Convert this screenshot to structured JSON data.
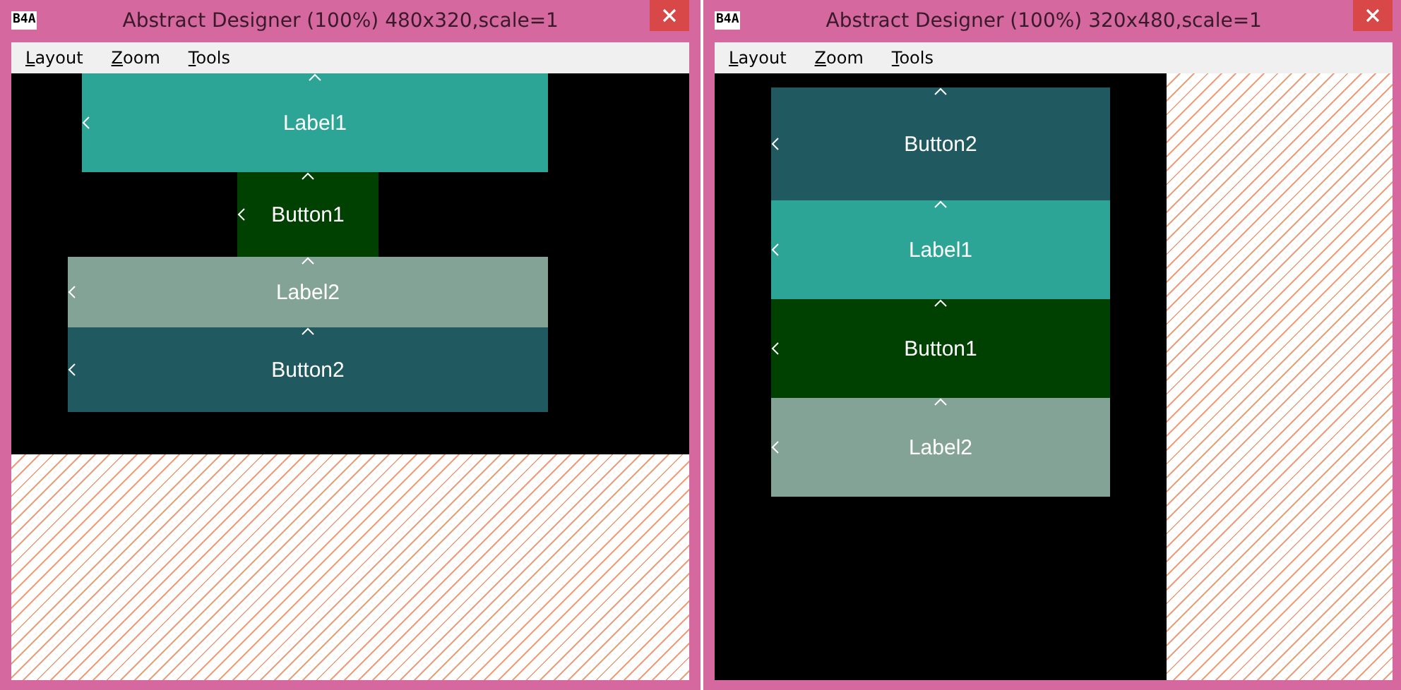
{
  "windows": [
    {
      "logo": "B4A",
      "title": "Abstract Designer (100%) 480x320,scale=1",
      "kind": "landscape",
      "menu": [
        "Layout",
        "Zoom",
        "Tools"
      ],
      "views": [
        {
          "text": "Label1",
          "color": "#2ca597"
        },
        {
          "text": "Button1",
          "color": "#004000"
        },
        {
          "text": "Label2",
          "color": "#84a397"
        },
        {
          "text": "Button2",
          "color": "#205a60"
        }
      ]
    },
    {
      "logo": "B4A",
      "title": "Abstract Designer (100%) 320x480,scale=1",
      "kind": "portrait",
      "menu": [
        "Layout",
        "Zoom",
        "Tools"
      ],
      "views": [
        {
          "text": "Button2",
          "color": "#205a60"
        },
        {
          "text": "Label1",
          "color": "#2ca597"
        },
        {
          "text": "Button1",
          "color": "#004000"
        },
        {
          "text": "Label2",
          "color": "#84a397"
        }
      ]
    }
  ]
}
